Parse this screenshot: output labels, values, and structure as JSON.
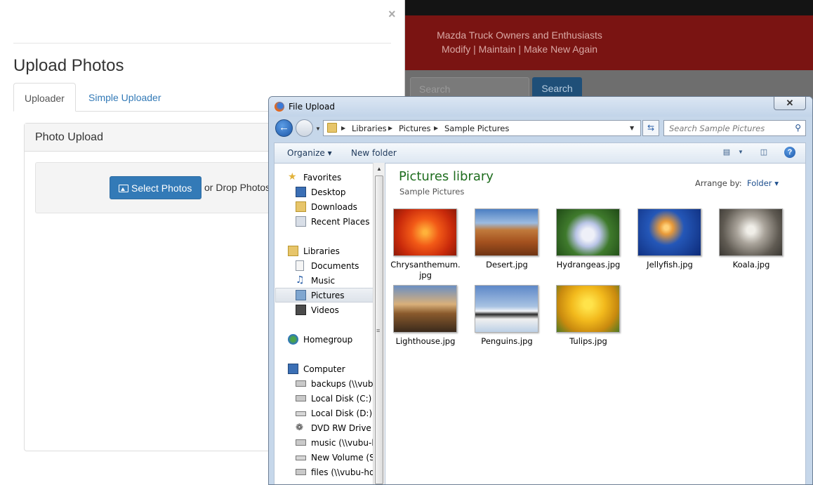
{
  "site": {
    "tagline_1": "Mazda Truck Owners and Enthusiasts",
    "tagline_2": "Modify | Maintain | Make New Again",
    "search_placeholder": "Search",
    "search_button": "Search"
  },
  "modal": {
    "close": "×",
    "title": "Upload Photos",
    "tabs": [
      {
        "label": "Uploader",
        "active": true
      },
      {
        "label": "Simple Uploader",
        "active": false
      }
    ],
    "panel_heading": "Photo Upload",
    "select_button": "Select Photos",
    "drop_text": "or Drop Photos"
  },
  "dialog": {
    "title": "File Upload",
    "close": "✕",
    "breadcrumb": [
      "Libraries",
      "Pictures",
      "Sample Pictures"
    ],
    "search_placeholder": "Search Sample Pictures",
    "toolbar": {
      "organize": "Organize",
      "new_folder": "New folder",
      "help": "?"
    },
    "nav": {
      "favorites": "Favorites",
      "desktop": "Desktop",
      "downloads": "Downloads",
      "recent": "Recent Places",
      "libraries": "Libraries",
      "documents": "Documents",
      "music": "Music",
      "pictures": "Pictures",
      "videos": "Videos",
      "homegroup": "Homegroup",
      "computer": "Computer",
      "drive_backups": "backups (\\\\vubu",
      "drive_c": "Local Disk (C:)",
      "drive_d": "Local Disk (D:)",
      "drive_e": "DVD RW Drive (E:",
      "drive_music": "music (\\\\vubu-h",
      "drive_s": "New Volume (S:)",
      "drive_files": "files (\\\\vubu-hor"
    },
    "library_title": "Pictures library",
    "library_subtitle": "Sample Pictures",
    "arrange_label": "Arrange by:",
    "arrange_value": "Folder",
    "files": [
      {
        "name": "Chrysanthemum.",
        "name2": "jpg"
      },
      {
        "name": "Desert.jpg",
        "name2": ""
      },
      {
        "name": "Hydrangeas.jpg",
        "name2": ""
      },
      {
        "name": "Jellyfish.jpg",
        "name2": ""
      },
      {
        "name": "Koala.jpg",
        "name2": ""
      },
      {
        "name": "Lighthouse.jpg",
        "name2": ""
      },
      {
        "name": "Penguins.jpg",
        "name2": ""
      },
      {
        "name": "Tulips.jpg",
        "name2": ""
      }
    ]
  }
}
